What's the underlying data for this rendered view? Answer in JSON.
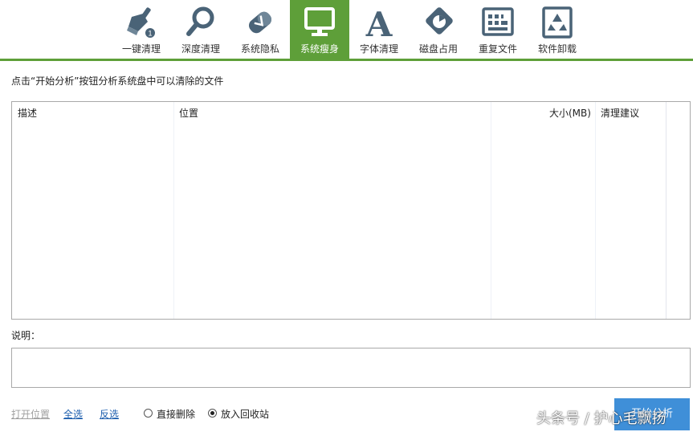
{
  "toolbar": {
    "items": [
      {
        "label": "一键清理",
        "icon": "broom-icon"
      },
      {
        "label": "深度清理",
        "icon": "magnifier-icon"
      },
      {
        "label": "系统隐私",
        "icon": "eraser-icon"
      },
      {
        "label": "系统瘦身",
        "icon": "monitor-icon",
        "active": true
      },
      {
        "label": "字体清理",
        "icon": "font-a-icon"
      },
      {
        "label": "磁盘占用",
        "icon": "disk-pie-icon"
      },
      {
        "label": "重复文件",
        "icon": "duplicate-files-icon"
      },
      {
        "label": "软件卸载",
        "icon": "recycle-icon"
      }
    ],
    "active_color": "#5e9f39",
    "icon_color": "#4a6377"
  },
  "hint": "点击“开始分析”按钮分析系统盘中可以清除的文件",
  "table": {
    "columns": [
      "描述",
      "位置",
      "大小(MB)",
      "清理建议"
    ],
    "rows": []
  },
  "description": {
    "label": "说明：",
    "text": ""
  },
  "bottom": {
    "open_location": "打开位置",
    "select_all": "全选",
    "invert_selection": "反选",
    "delete_mode": {
      "options": [
        "直接删除",
        "放入回收站"
      ],
      "selected": "放入回收站"
    },
    "start_button": "开始分析",
    "start_color": "#3f8fd8"
  },
  "watermark": "头条号 / 护心毛飘扬"
}
